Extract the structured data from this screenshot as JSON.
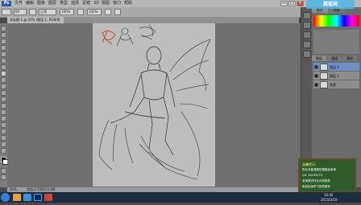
{
  "app": {
    "logo": "Ps",
    "menu": [
      "文件",
      "编辑",
      "图像",
      "图层",
      "类型",
      "选择",
      "滤镜",
      "3D",
      "视图",
      "窗口",
      "帮助"
    ],
    "window_controls": [
      "—",
      "□",
      "✕"
    ]
  },
  "options": {
    "brush_size": "80",
    "mode": "正常",
    "opacity": "100%",
    "flow": "100%"
  },
  "document": {
    "tab_label": "未标题-1 @ 50% (图层 1, RGB/8)"
  },
  "status": {
    "zoom": "50%",
    "doc_info": "文档:2.25M/10.0M"
  },
  "panels": {
    "tabs": [
      "颜色",
      "色板"
    ],
    "layer_tabs": [
      "图层",
      "通道",
      "路径"
    ],
    "layers": [
      {
        "name": "图层 2",
        "active": true
      },
      {
        "name": "图层 1",
        "active": false
      },
      {
        "name": "背景",
        "active": false
      }
    ]
  },
  "watermark": "翼狐网",
  "info_board": {
    "title": "温馨提示:",
    "lines": [
      "购买本套课程的童鞋加老师",
      "Q4: 94155074",
      "老师提供作业评改指导",
      "免费绘画学习指导服务"
    ]
  },
  "taskbar": {
    "time": "16:42",
    "date": "2015/3/10"
  },
  "colors": {
    "accent": "#3a7bd5",
    "board": "#2e5b2a",
    "sketch_red": "#c0392b",
    "sketch_gray": "#3a3a3a"
  }
}
